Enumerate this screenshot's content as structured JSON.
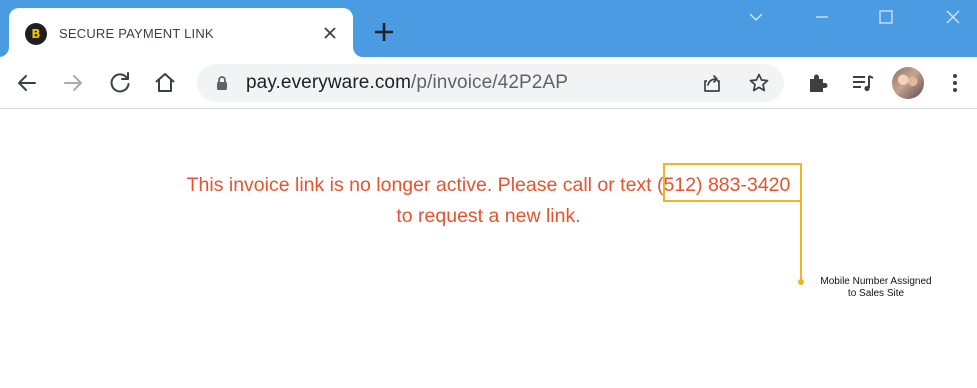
{
  "browser": {
    "tab": {
      "favicon_glyph": "B",
      "title": "SECURE PAYMENT LINK"
    },
    "address_bar": {
      "host": "pay.everyware.com",
      "path": "/p/invoice/42P2AP"
    },
    "icons": [
      "back-icon",
      "forward-icon",
      "reload-icon",
      "home-icon",
      "lock-icon",
      "share-icon",
      "star-icon",
      "extensions-icon",
      "media-icon",
      "profile-avatar",
      "menu-icon",
      "minimize-icon",
      "maximize-icon",
      "close-window-icon",
      "tab-search-icon",
      "new-tab-icon",
      "tab-close-icon"
    ],
    "colors": {
      "tabstrip": "#4a9be1",
      "message_text": "#e4542f",
      "annotation_highlight": "#f0b429"
    }
  },
  "page": {
    "message_before": "This invoice link is no longer active. Please call or text",
    "phone_number": "(512) 883-3420",
    "message_after": "to request a new link."
  },
  "annotation": {
    "line1": "Mobile Number Assigned",
    "line2": "to Sales Site"
  }
}
